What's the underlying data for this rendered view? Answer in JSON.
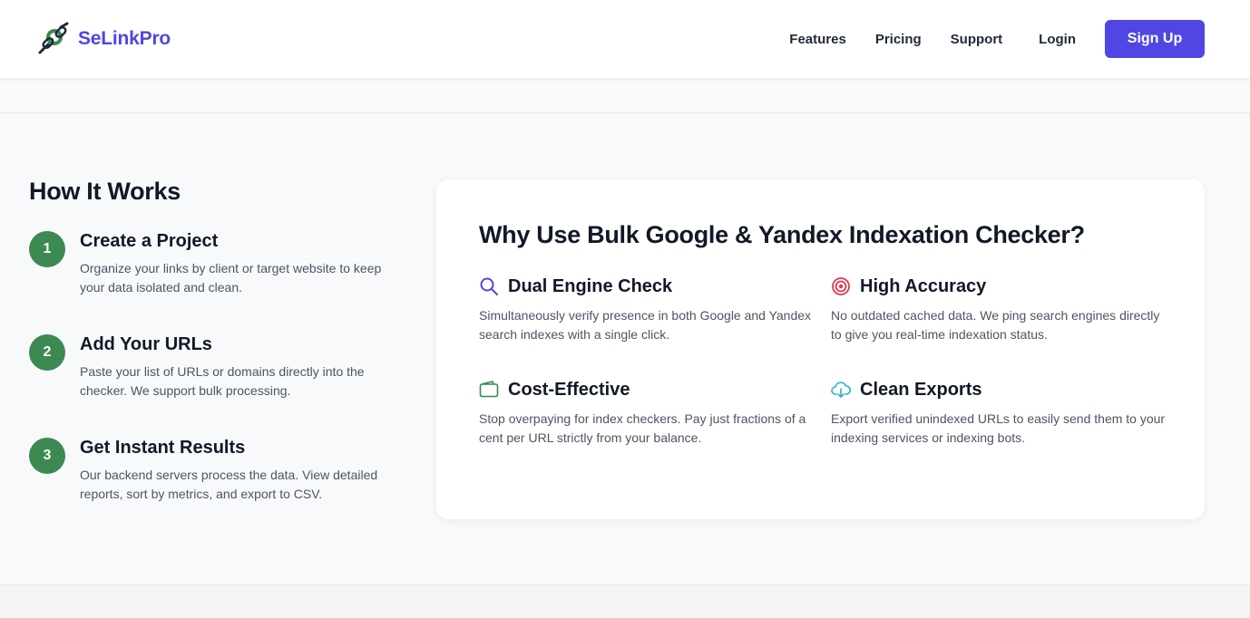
{
  "header": {
    "brand": "SeLinkPro",
    "nav": {
      "features": "Features",
      "pricing": "Pricing",
      "support": "Support",
      "login": "Login",
      "signup": "Sign Up"
    }
  },
  "how_it_works": {
    "title": "How It Works",
    "steps": [
      {
        "number": "1",
        "title": "Create a Project",
        "description": "Organize your links by client or target website to keep your data isolated and clean."
      },
      {
        "number": "2",
        "title": "Add Your URLs",
        "description": "Paste your list of URLs or domains directly into the checker. We support bulk processing."
      },
      {
        "number": "3",
        "title": "Get Instant Results",
        "description": "Our backend servers process the data. View detailed reports, sort by metrics, and export to CSV."
      }
    ]
  },
  "why_use": {
    "title": "Why Use Bulk Google & Yandex Indexation Checker?",
    "features": [
      {
        "icon": "search-icon",
        "title": "Dual Engine Check",
        "description": "Simultaneously verify presence in both Google and Yandex search indexes with a single click."
      },
      {
        "icon": "target-icon",
        "title": "High Accuracy",
        "description": "No outdated cached data. We ping search engines directly to give you real-time indexation status."
      },
      {
        "icon": "wallet-icon",
        "title": "Cost-Effective",
        "description": "Stop overpaying for index checkers. Pay just fractions of a cent per URL strictly from your balance."
      },
      {
        "icon": "cloud-download-icon",
        "title": "Clean Exports",
        "description": "Export verified unindexed URLs to easily send them to your indexing services or indexing bots."
      }
    ]
  },
  "colors": {
    "brand": "#5046e4",
    "step_badge": "#3c8a52",
    "search_icon": "#5046e4",
    "target_icon": "#e0364f",
    "wallet_icon": "#2f8a4f",
    "cloud_icon": "#2bb0c8"
  }
}
